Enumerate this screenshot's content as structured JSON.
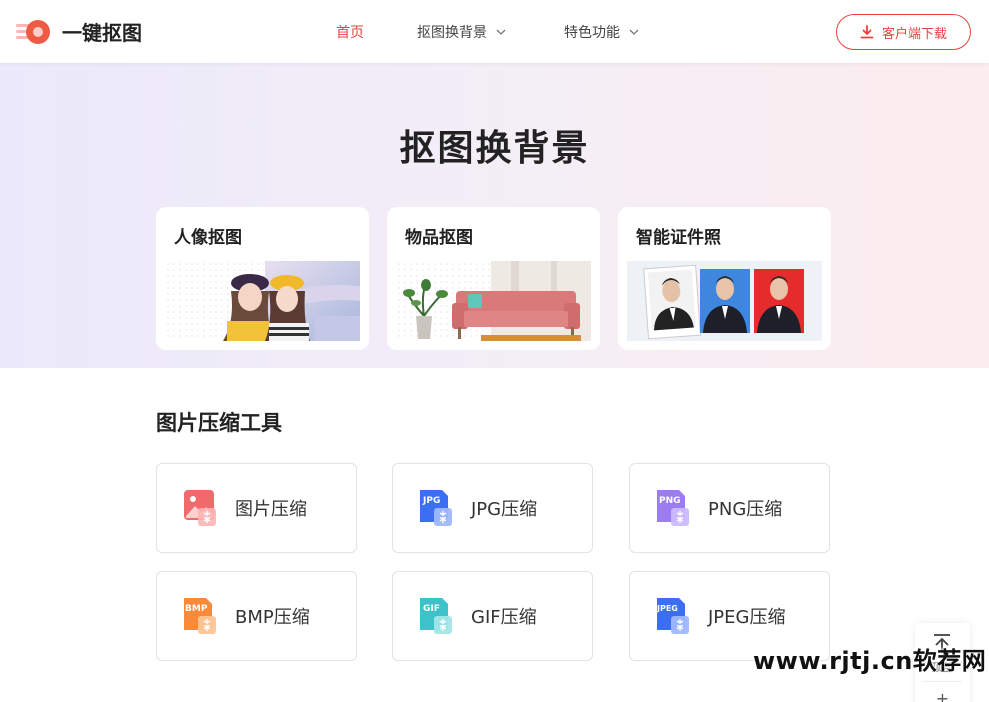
{
  "header": {
    "logo_text": "一键抠图",
    "nav": [
      {
        "label": "首页",
        "active": true
      },
      {
        "label": "抠图换背景",
        "dropdown": true
      },
      {
        "label": "特色功能",
        "dropdown": true
      }
    ],
    "download_label": "客户端下载"
  },
  "hero": {
    "title": "抠图换背景",
    "cards": [
      {
        "title": "人像抠图"
      },
      {
        "title": "物品抠图"
      },
      {
        "title": "智能证件照"
      }
    ]
  },
  "tools": {
    "title": "图片压缩工具",
    "items": [
      {
        "label": "图片压缩",
        "icon": "image-compress-icon",
        "color": "#f0696b"
      },
      {
        "label": "JPG压缩",
        "icon": "jpg-compress-icon",
        "badge": "JPG",
        "color": "#3b6ff0"
      },
      {
        "label": "PNG压缩",
        "icon": "png-compress-icon",
        "badge": "PNG",
        "color": "#9b7cf2"
      },
      {
        "label": "BMP压缩",
        "icon": "bmp-compress-icon",
        "badge": "BMP",
        "color": "#f88a3a"
      },
      {
        "label": "GIF压缩",
        "icon": "gif-compress-icon",
        "badge": "GIF",
        "color": "#3cc3c9"
      },
      {
        "label": "JPEG压缩",
        "icon": "jpeg-compress-icon",
        "badge": "JPEG",
        "color": "#3b6ff0"
      }
    ]
  },
  "side_widget": {
    "top_label": "顶部",
    "plus": "+"
  },
  "watermark": "www.rjtj.cn软荐网",
  "colors": {
    "accent": "#e8443f"
  }
}
